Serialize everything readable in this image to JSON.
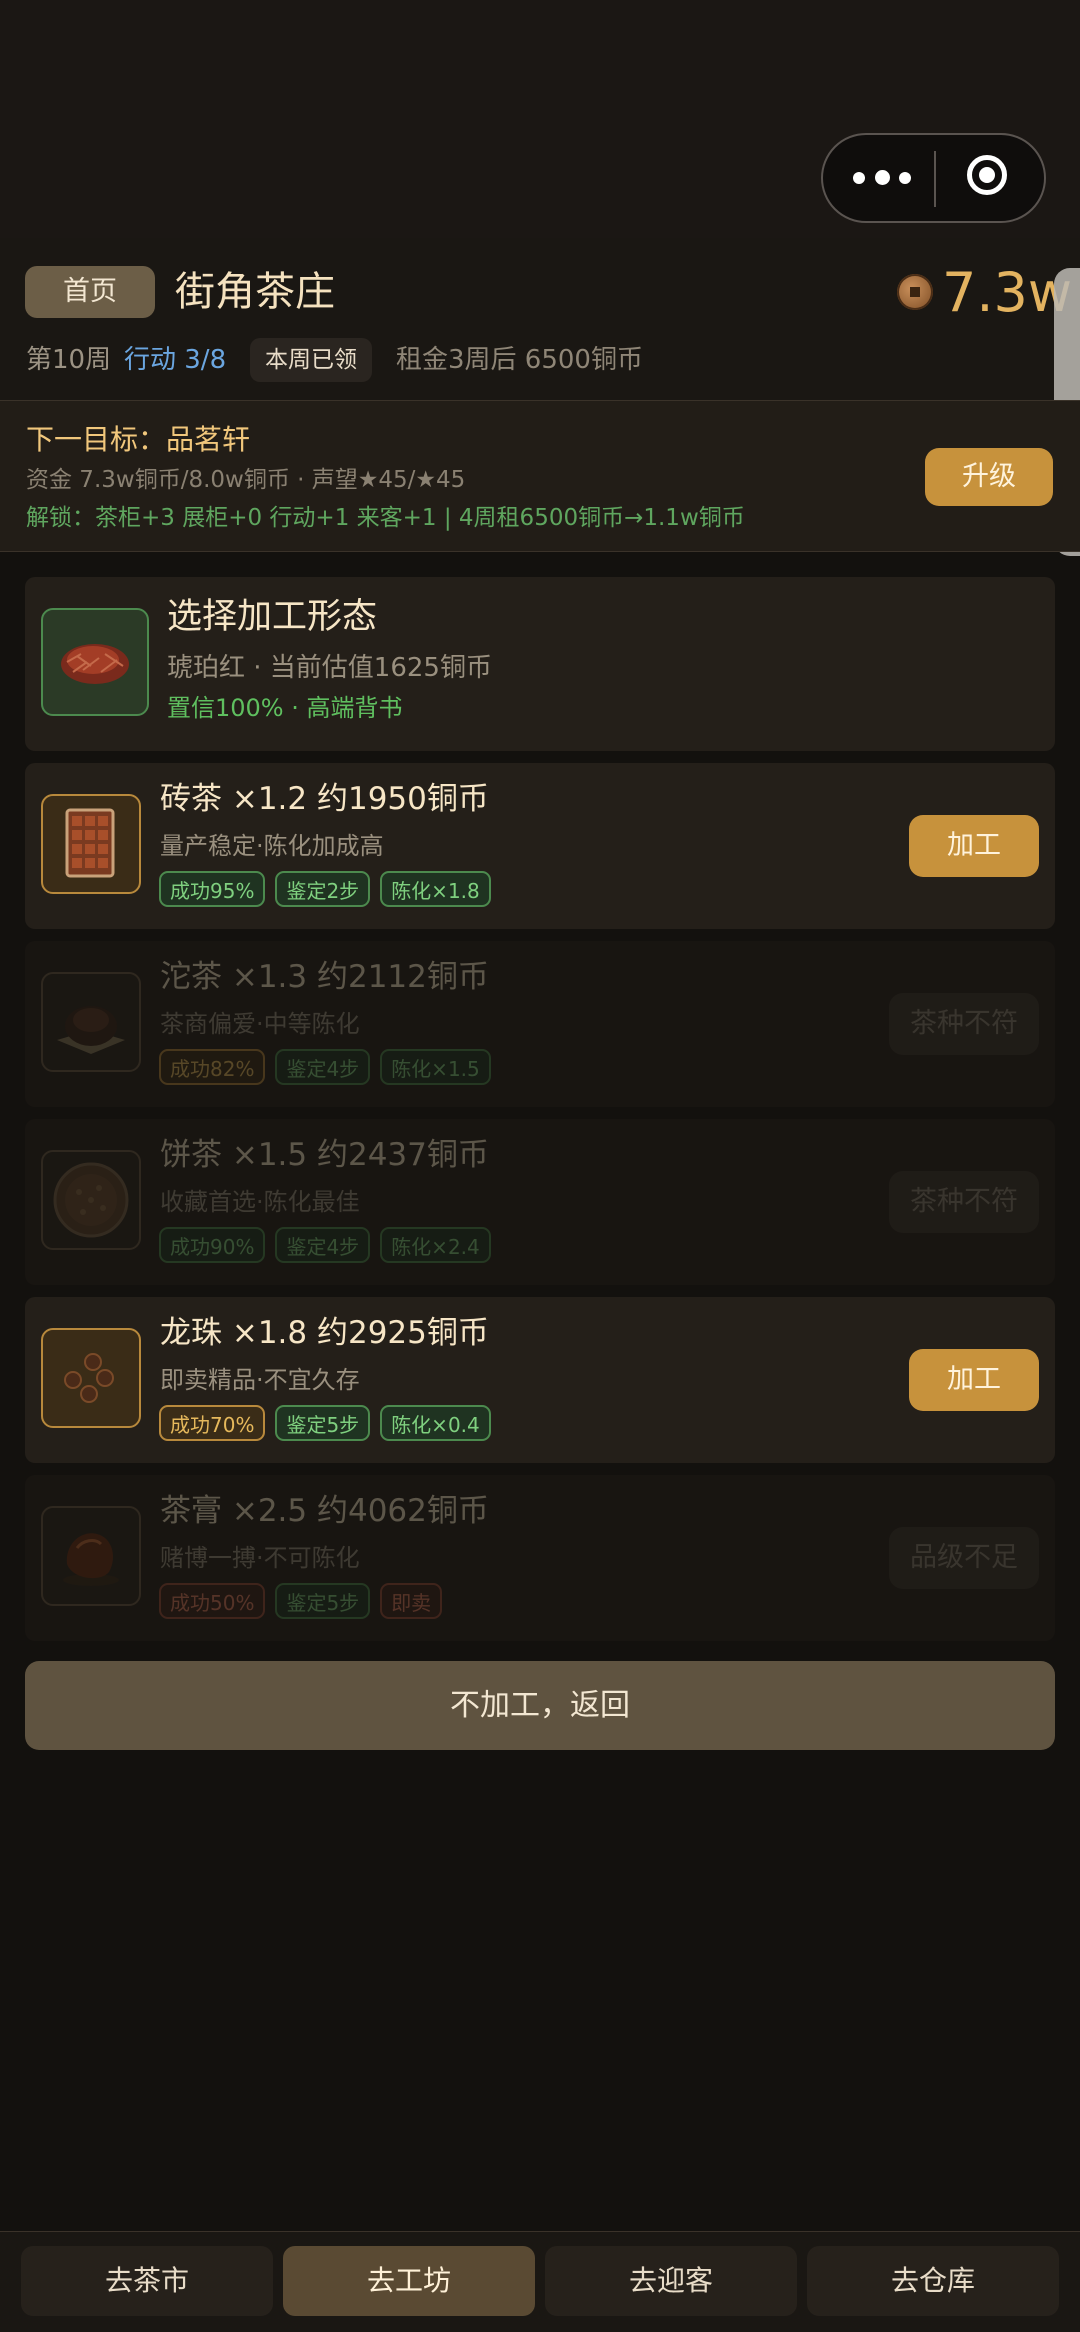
{
  "capsule": {
    "more_icon": "more-dots-icon",
    "record_icon": "record-target-icon"
  },
  "header": {
    "home_label": "首页",
    "shop_name": "街角茶庄",
    "money": "7.3w",
    "week": "第10周",
    "actions": "行动 3/8",
    "claimed": "本周已领",
    "rent": "租金3周后 6500铜币"
  },
  "goal": {
    "title": "下一目标：品茗轩",
    "funds": "资金 7.3w铜币/8.0w铜币 · 声望★45/★45",
    "unlock": "解锁：茶柜+3 展柜+0 行动+1 来客+1 | 4周租6500铜币→1.1w铜币",
    "upgrade_label": "升级"
  },
  "select": {
    "title": "选择加工形态",
    "sub": "琥珀红 · 当前估值1625铜币",
    "note": "置信100% · 高端背书"
  },
  "options": [
    {
      "title": "砖茶 ×1.2  约1950铜币",
      "sub": "量产稳定·陈化加成高",
      "tags": [
        "成功95%",
        "鉴定2步",
        "陈化×1.8"
      ],
      "button": "加工",
      "enabled": true
    },
    {
      "title": "沱茶 ×1.3  约2112铜币",
      "sub": "茶商偏爱·中等陈化",
      "tags": [
        "成功82%",
        "鉴定4步",
        "陈化×1.5"
      ],
      "button": "茶种不符",
      "enabled": false
    },
    {
      "title": "饼茶 ×1.5  约2437铜币",
      "sub": "收藏首选·陈化最佳",
      "tags": [
        "成功90%",
        "鉴定4步",
        "陈化×2.4"
      ],
      "button": "茶种不符",
      "enabled": false
    },
    {
      "title": "龙珠 ×1.8  约2925铜币",
      "sub": "即卖精品·不宜久存",
      "tags": [
        "成功70%",
        "鉴定5步",
        "陈化×0.4"
      ],
      "button": "加工",
      "enabled": true
    },
    {
      "title": "茶膏 ×2.5  约4062铜币",
      "sub": "赌博一搏·不可陈化",
      "tags": [
        "成功50%",
        "鉴定5步",
        "即卖"
      ],
      "button": "品级不足",
      "enabled": false
    }
  ],
  "back_label": "不加工，返回",
  "nav": [
    "去茶市",
    "去工坊",
    "去迎客",
    "去仓库"
  ],
  "nav_active": "去工坊",
  "colors": {
    "accent": "#c7923c",
    "success": "#7fd07f",
    "gold": "#e6b95c",
    "danger": "#e07a5e",
    "link": "#6ba6e0"
  }
}
